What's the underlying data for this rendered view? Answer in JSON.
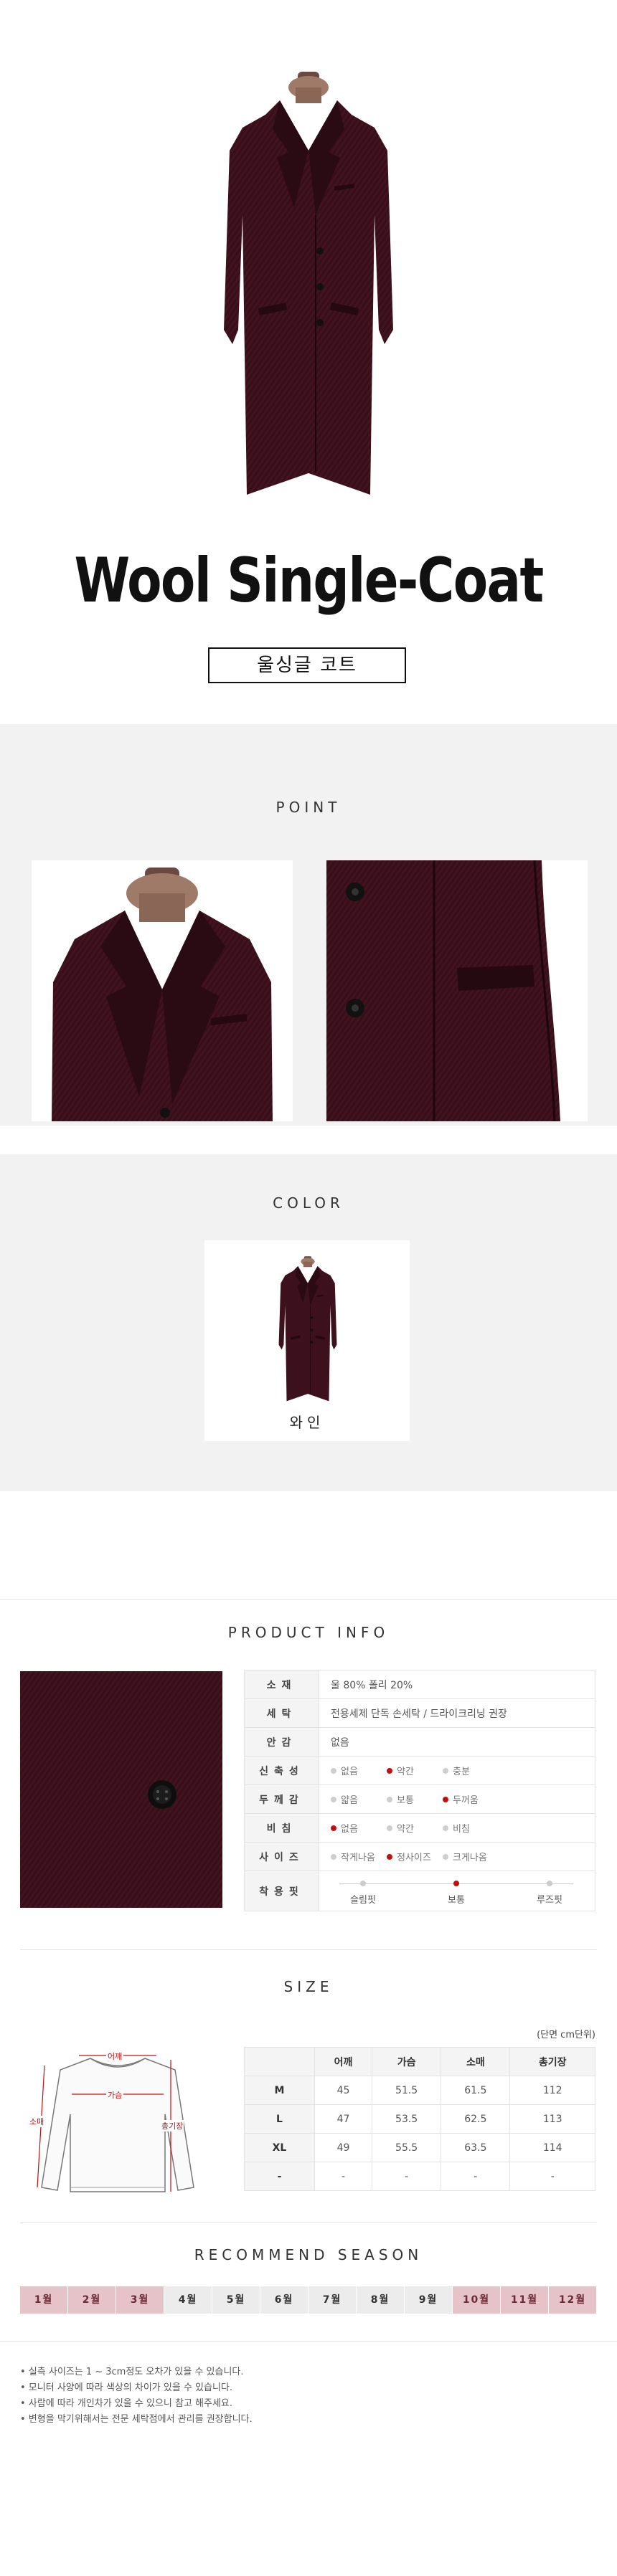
{
  "colors": {
    "wine": "#3b0d1a",
    "accent_red": "#c01010",
    "season_on": "#e6c2c9",
    "panel_grey": "#f2f2f2"
  },
  "hero": {
    "title": "Wool Single-Coat",
    "subtitle": "울싱글 코트"
  },
  "point": {
    "heading": "POINT"
  },
  "color": {
    "heading": "COLOR",
    "swatches": [
      {
        "label": "와인",
        "hex": "#3b0d1a"
      }
    ]
  },
  "product_info": {
    "heading": "PRODUCT INFO",
    "rows": [
      {
        "label": "소재",
        "value": "울 80% 폴리 20%"
      },
      {
        "label": "세탁",
        "value": "전용세제 단독 손세탁 / 드라이크리닝 권장"
      },
      {
        "label": "안감",
        "value": "없음"
      }
    ],
    "option_rows": [
      {
        "label": "신축성",
        "options": [
          "없음",
          "약간",
          "충분"
        ],
        "selected": 1
      },
      {
        "label": "두께감",
        "options": [
          "얇음",
          "보통",
          "두꺼움"
        ],
        "selected": 2
      },
      {
        "label": "비침",
        "options": [
          "없음",
          "약간",
          "비침"
        ],
        "selected": 0
      },
      {
        "label": "사이즈",
        "options": [
          "작게나옴",
          "정사이즈",
          "크게나옴"
        ],
        "selected": 1
      }
    ],
    "fit": {
      "label": "착용핏",
      "options": [
        "슬림핏",
        "보통",
        "루즈핏"
      ],
      "selected": 1
    }
  },
  "size": {
    "heading": "SIZE",
    "unit": "(단면 cm단위)",
    "diagram_labels": {
      "shoulder": "어깨",
      "chest": "가슴",
      "sleeve": "소매",
      "length": "총기장"
    },
    "columns": [
      "",
      "어깨",
      "가슴",
      "소매",
      "총기장"
    ],
    "rows": [
      [
        "M",
        "45",
        "51.5",
        "61.5",
        "112"
      ],
      [
        "L",
        "47",
        "53.5",
        "62.5",
        "113"
      ],
      [
        "XL",
        "49",
        "55.5",
        "63.5",
        "114"
      ],
      [
        "-",
        "-",
        "-",
        "-",
        "-"
      ]
    ]
  },
  "season": {
    "heading": "RECOMMEND SEASON",
    "months": [
      {
        "label": "1월",
        "active": true
      },
      {
        "label": "2월",
        "active": true
      },
      {
        "label": "3월",
        "active": true
      },
      {
        "label": "4월",
        "active": false
      },
      {
        "label": "5월",
        "active": false
      },
      {
        "label": "6월",
        "active": false
      },
      {
        "label": "7월",
        "active": false
      },
      {
        "label": "8월",
        "active": false
      },
      {
        "label": "9월",
        "active": false
      },
      {
        "label": "10월",
        "active": true
      },
      {
        "label": "11월",
        "active": true
      },
      {
        "label": "12월",
        "active": true
      }
    ]
  },
  "notes": [
    "• 실측 사이즈는 1 ~ 3cm정도 오차가 있을 수 있습니다.",
    "• 모니터 사양에 따라 색상의 차이가 있을 수 있습니다.",
    "• 사람에 따라 개인차가 있을 수 있으니 참고 해주세요.",
    "• 변형을 막기위해서는 전문 세탁점에서 관리를 권장합니다."
  ]
}
